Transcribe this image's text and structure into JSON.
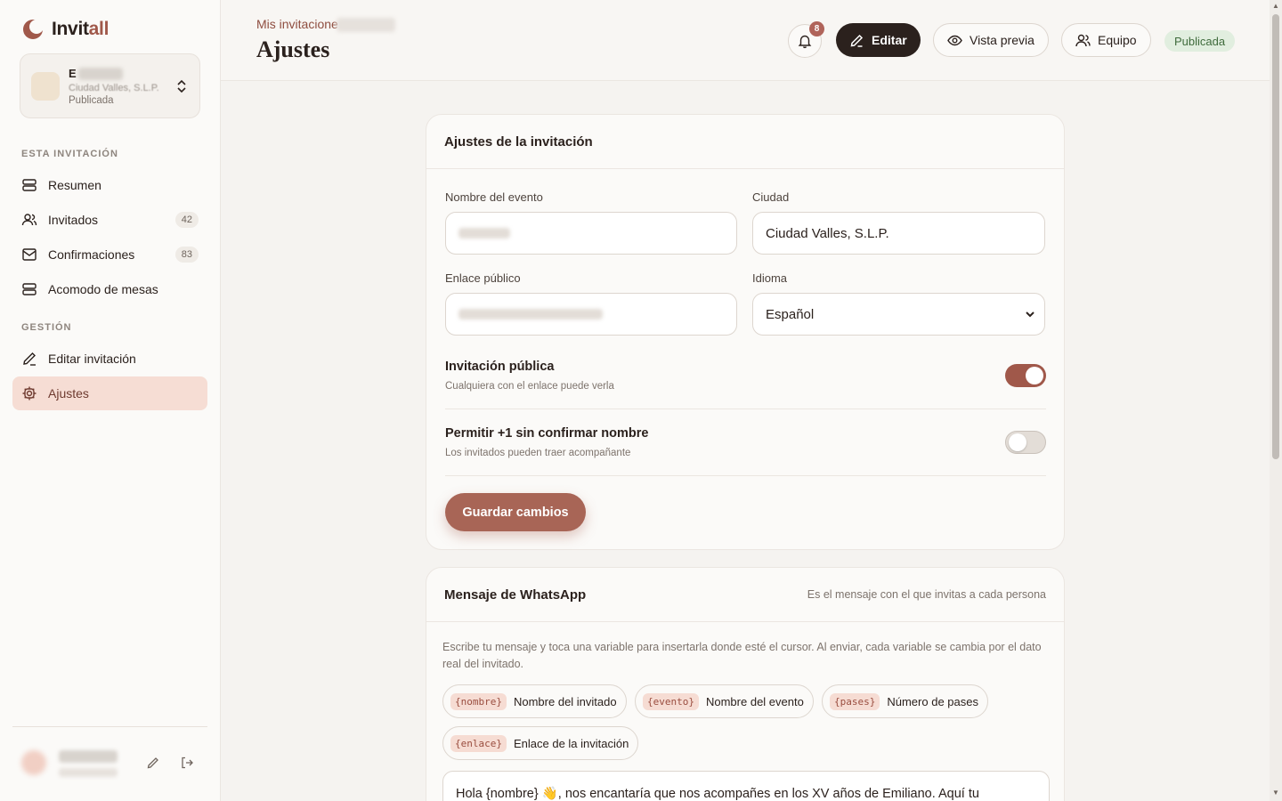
{
  "brand": {
    "name_main": "Invit",
    "name_accent": "all"
  },
  "event_card": {
    "name": "E",
    "city": "Ciudad Valles, S.L.P.",
    "status": "Publicada"
  },
  "sidebar": {
    "section_this": "ESTA INVITACIÓN",
    "section_manage": "GESTIÓN",
    "items": [
      {
        "label": "Resumen",
        "icon": "layers-icon"
      },
      {
        "label": "Invitados",
        "icon": "users-icon",
        "count": "42"
      },
      {
        "label": "Confirmaciones",
        "icon": "mail-icon",
        "count": "83"
      },
      {
        "label": "Acomodo de mesas",
        "icon": "table-icon"
      },
      {
        "label": "Editar invitación",
        "icon": "pencil-icon"
      },
      {
        "label": "Ajustes",
        "icon": "gear-icon",
        "active": true
      }
    ]
  },
  "header": {
    "breadcrumb": "Mis invitacione",
    "title": "Ajustes",
    "notifications": "8",
    "edit_label": "Editar",
    "preview_label": "Vista previa",
    "team_label": "Equipo",
    "status": "Publicada"
  },
  "settings": {
    "title": "Ajustes de la invitación",
    "event_name_label": "Nombre del evento",
    "city_label": "Ciudad",
    "city_value": "Ciudad Valles, S.L.P.",
    "public_link_label": "Enlace público",
    "language_label": "Idioma",
    "language_value": "Español",
    "public_title": "Invitación pública",
    "public_sub": "Cualquiera con el enlace puede verla",
    "public_on": true,
    "plusone_title": "Permitir +1 sin confirmar nombre",
    "plusone_sub": "Los invitados pueden traer acompañante",
    "plusone_on": false,
    "save_label": "Guardar cambios"
  },
  "whatsapp": {
    "title": "Mensaje de WhatsApp",
    "hint": "Es el mensaje con el que invitas a cada persona",
    "description": "Escribe tu mensaje y toca una variable para insertarla donde esté el cursor. Al enviar, cada variable se cambia por el dato real del invitado.",
    "variables": [
      {
        "token": "{nombre}",
        "label": "Nombre del invitado"
      },
      {
        "token": "{evento}",
        "label": "Nombre del evento"
      },
      {
        "token": "{pases}",
        "label": "Número de pases"
      },
      {
        "token": "{enlace}",
        "label": "Enlace de la invitación"
      }
    ],
    "message": "Hola {nombre} 👋, nos encantaría que nos acompañes en los XV años de Emiliano. Aquí tu"
  },
  "colors": {
    "accent": "#a0584a",
    "dark": "#2b211d",
    "active_bg": "#f6ddd4",
    "status_bg": "#e1eedf"
  }
}
